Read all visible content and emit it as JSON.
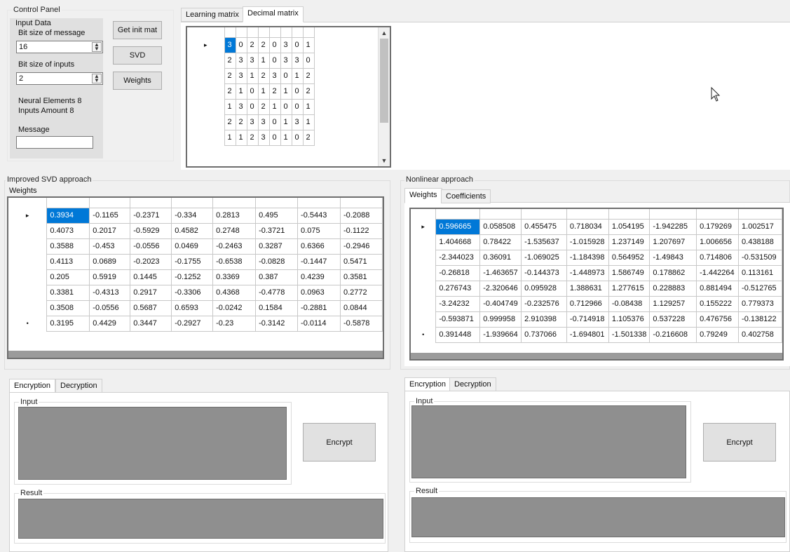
{
  "control_panel": {
    "title": "Control Panel",
    "input_data_title": "Input Data",
    "bit_size_message_label": "Bit size of message",
    "bit_size_message_value": "16",
    "bit_size_inputs_label": "Bit size of inputs",
    "bit_size_inputs_value": "2",
    "neural_elements": "Neural Elements 8",
    "inputs_amount": "Inputs Amount 8",
    "message_label": "Message",
    "message_value": "",
    "buttons": {
      "get_init_mat": "Get init mat",
      "svd": "SVD",
      "weights": "Weights"
    }
  },
  "matrix_tabs": {
    "learning": "Learning matrix",
    "decimal": "Decimal matrix"
  },
  "learning_matrix": [
    [
      "3",
      "0",
      "2",
      "2",
      "0",
      "3",
      "0",
      "1"
    ],
    [
      "2",
      "3",
      "3",
      "1",
      "0",
      "3",
      "3",
      "0"
    ],
    [
      "2",
      "3",
      "1",
      "2",
      "3",
      "0",
      "1",
      "2"
    ],
    [
      "2",
      "1",
      "0",
      "1",
      "2",
      "1",
      "0",
      "2"
    ],
    [
      "1",
      "3",
      "0",
      "2",
      "1",
      "0",
      "0",
      "1"
    ],
    [
      "2",
      "2",
      "3",
      "3",
      "0",
      "1",
      "3",
      "1"
    ],
    [
      "1",
      "1",
      "2",
      "3",
      "0",
      "1",
      "0",
      "2"
    ]
  ],
  "svd": {
    "title": "Improved SVD approach",
    "weights_title": "Weights",
    "rows": [
      [
        "0.3934",
        "-0.1165",
        "-0.2371",
        "-0.334",
        "0.2813",
        "0.495",
        "-0.5443",
        "-0.2088"
      ],
      [
        "0.4073",
        "0.2017",
        "-0.5929",
        "0.4582",
        "0.2748",
        "-0.3721",
        "0.075",
        "-0.1122"
      ],
      [
        "0.3588",
        "-0.453",
        "-0.0556",
        "0.0469",
        "-0.2463",
        "0.3287",
        "0.6366",
        "-0.2946"
      ],
      [
        "0.4113",
        "0.0689",
        "-0.2023",
        "-0.1755",
        "-0.6538",
        "-0.0828",
        "-0.1447",
        "0.5471"
      ],
      [
        "0.205",
        "0.5919",
        "0.1445",
        "-0.1252",
        "0.3369",
        "0.387",
        "0.4239",
        "0.3581"
      ],
      [
        "0.3381",
        "-0.4313",
        "0.2917",
        "-0.3306",
        "0.4368",
        "-0.4778",
        "0.0963",
        "0.2772"
      ],
      [
        "0.3508",
        "-0.0556",
        "0.5687",
        "0.6593",
        "-0.0242",
        "0.1584",
        "-0.2881",
        "0.0844"
      ],
      [
        "0.3195",
        "0.4429",
        "0.3447",
        "-0.2927",
        "-0.23",
        "-0.3142",
        "-0.0114",
        "-0.5878"
      ]
    ],
    "tabs": {
      "encryption": "Encryption",
      "decryption": "Decryption"
    },
    "input_label": "Input",
    "result_label": "Result",
    "encrypt_button": "Encrypt"
  },
  "nonlinear": {
    "title": "Nonlinear approach",
    "tabs_top": {
      "weights": "Weights",
      "coefficients": "Coefficients"
    },
    "rows": [
      [
        "0.596665",
        "0.058508",
        "0.455475",
        "0.718034",
        "1.054195",
        "-1.942285",
        "0.179269",
        "1.002517"
      ],
      [
        "1.404668",
        "0.78422",
        "-1.535637",
        "-1.015928",
        "1.237149",
        "1.207697",
        "1.006656",
        "0.438188"
      ],
      [
        "-2.344023",
        "0.36091",
        "-1.069025",
        "-1.184398",
        "0.564952",
        "-1.49843",
        "0.714806",
        "-0.531509"
      ],
      [
        "-0.26818",
        "-1.463657",
        "-0.144373",
        "-1.448973",
        "1.586749",
        "0.178862",
        "-1.442264",
        "0.113161"
      ],
      [
        "0.276743",
        "-2.320646",
        "0.095928",
        "1.388631",
        "1.277615",
        "0.228883",
        "0.881494",
        "-0.512765"
      ],
      [
        "-3.24232",
        "-0.404749",
        "-0.232576",
        "0.712966",
        "-0.08438",
        "1.129257",
        "0.155222",
        "0.779373"
      ],
      [
        "-0.593871",
        "0.999958",
        "2.910398",
        "-0.714918",
        "1.105376",
        "0.537228",
        "0.476756",
        "-0.138122"
      ],
      [
        "0.391448",
        "-1.939664",
        "0.737066",
        "-1.694801",
        "-1.501338",
        "-0.216608",
        "0.79249",
        "0.402758"
      ]
    ],
    "tabs": {
      "encryption": "Encryption",
      "decryption": "Decryption"
    },
    "input_label": "Input",
    "result_label": "Result",
    "encrypt_button": "Encrypt"
  },
  "row_markers": {
    "current": "▸",
    "new": "•"
  },
  "icons": {
    "spin": "spin-arrows-icon",
    "scroll_up": "chevron-up-icon",
    "scroll_down": "chevron-down-icon",
    "cursor": "mouse-cursor-icon"
  }
}
